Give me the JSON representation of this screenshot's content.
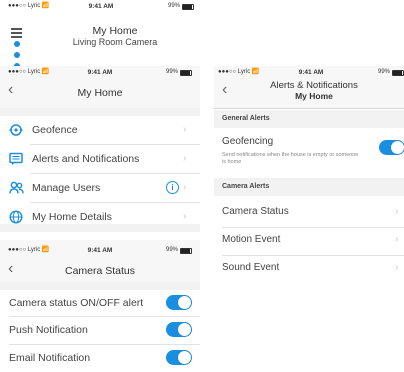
{
  "status_bar": {
    "carrier": "●●●○○ Lyric 📶",
    "time": "9:41 AM",
    "battery": "99%"
  },
  "top_header": {
    "title": "My Home",
    "subtitle": "Living Room Camera"
  },
  "my_home": {
    "title": "My Home",
    "items": [
      {
        "label": "Geofence",
        "icon": "location-pin-icon"
      },
      {
        "label": "Alerts and Notifications",
        "icon": "chat-icon"
      },
      {
        "label": "Manage Users",
        "icon": "users-icon"
      },
      {
        "label": "My Home Details",
        "icon": "globe-icon"
      }
    ]
  },
  "camera_status": {
    "title": "Camera Status",
    "toggles": [
      {
        "label": "Camera status ON/OFF alert",
        "on": true
      },
      {
        "label": "Push Notification",
        "on": true
      },
      {
        "label": "Email Notification",
        "on": true
      }
    ]
  },
  "alerts_screen": {
    "title": "Alerts & Notifications",
    "subtitle": "My Home",
    "general_header": "General Alerts",
    "geofencing_label": "Geofencing",
    "geofencing_desc": "Send notifications when the house is empty or someone is home",
    "camera_header": "Camera Alerts",
    "camera_items": [
      "Camera Status",
      "Motion Event",
      "Sound Event"
    ]
  },
  "colors": {
    "accent": "#1a8fe0",
    "toggle_on": "#1a8fe0"
  }
}
